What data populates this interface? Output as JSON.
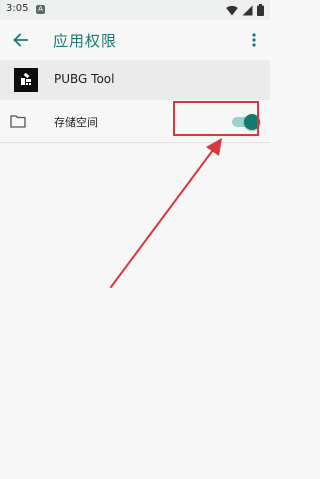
{
  "status_bar": {
    "time": "3:05",
    "notification_badge": "A",
    "icons": [
      "wifi-icon",
      "signal-icon",
      "battery-icon"
    ]
  },
  "toolbar": {
    "title": "应用权限",
    "back_icon": "arrow-left-icon",
    "more_icon": "more-vert-icon",
    "accent_color": "#1b7a73"
  },
  "app": {
    "name": "PUBG Tool",
    "icon": "app-icon"
  },
  "permissions": [
    {
      "label": "存储空间",
      "icon": "folder-icon",
      "enabled": true
    }
  ],
  "annotation": {
    "highlight_color": "#d9363e"
  }
}
